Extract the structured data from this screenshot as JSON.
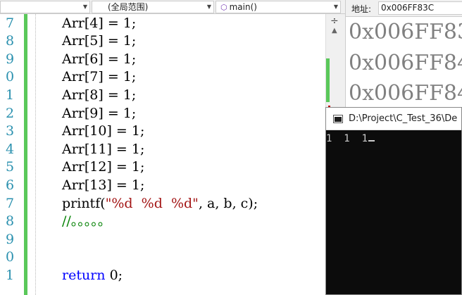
{
  "navbar": {
    "project_dropdown": "",
    "scope_dropdown": "(全局范围)",
    "function_dropdown": "main()"
  },
  "editor": {
    "lines": [
      {
        "ln": "7",
        "tokens": [
          {
            "t": "Arr[4] = 1;",
            "c": "code"
          }
        ]
      },
      {
        "ln": "8",
        "tokens": [
          {
            "t": "Arr[5] = 1;",
            "c": "code"
          }
        ]
      },
      {
        "ln": "9",
        "tokens": [
          {
            "t": "Arr[6] = 1;",
            "c": "code"
          }
        ]
      },
      {
        "ln": "0",
        "tokens": [
          {
            "t": "Arr[7] = 1;",
            "c": "code"
          }
        ]
      },
      {
        "ln": "1",
        "tokens": [
          {
            "t": "Arr[8] = 1;",
            "c": "code"
          }
        ]
      },
      {
        "ln": "2",
        "tokens": [
          {
            "t": "Arr[9] = 1;",
            "c": "code"
          }
        ]
      },
      {
        "ln": "3",
        "tokens": [
          {
            "t": "Arr[10] = 1;",
            "c": "code"
          }
        ]
      },
      {
        "ln": "4",
        "tokens": [
          {
            "t": "Arr[11] = 1;",
            "c": "code"
          }
        ]
      },
      {
        "ln": "5",
        "tokens": [
          {
            "t": "Arr[12] = 1;",
            "c": "code"
          }
        ]
      },
      {
        "ln": "6",
        "tokens": [
          {
            "t": "Arr[13] = 1;",
            "c": "code"
          }
        ]
      },
      {
        "ln": "7",
        "tokens": [
          {
            "t": "printf(",
            "c": "code"
          },
          {
            "t": "\"%d  %d  %d\"",
            "c": "str"
          },
          {
            "t": ", a, b, c);",
            "c": "code"
          }
        ]
      },
      {
        "ln": "8",
        "tokens": [
          {
            "t": "//。。。。。",
            "c": "cmt"
          }
        ]
      },
      {
        "ln": "9",
        "tokens": []
      },
      {
        "ln": "0",
        "tokens": []
      },
      {
        "ln": "1",
        "tokens": [
          {
            "t": "return",
            "c": "kw"
          },
          {
            "t": " 0;",
            "c": "code"
          }
        ]
      }
    ]
  },
  "memory": {
    "address_label": "地址:",
    "address_value": "0x006FF83C",
    "rows": [
      "0x006FF83",
      "0x006FF84",
      "0x006FF84"
    ]
  },
  "console": {
    "title": "D:\\Project\\C_Test_36\\De",
    "output": "1  1  1"
  },
  "colors": {
    "keyword": "#0000ff",
    "string": "#a31515",
    "comment": "#008000",
    "line_number": "#2b91af",
    "change_bar": "#5ac85a"
  }
}
